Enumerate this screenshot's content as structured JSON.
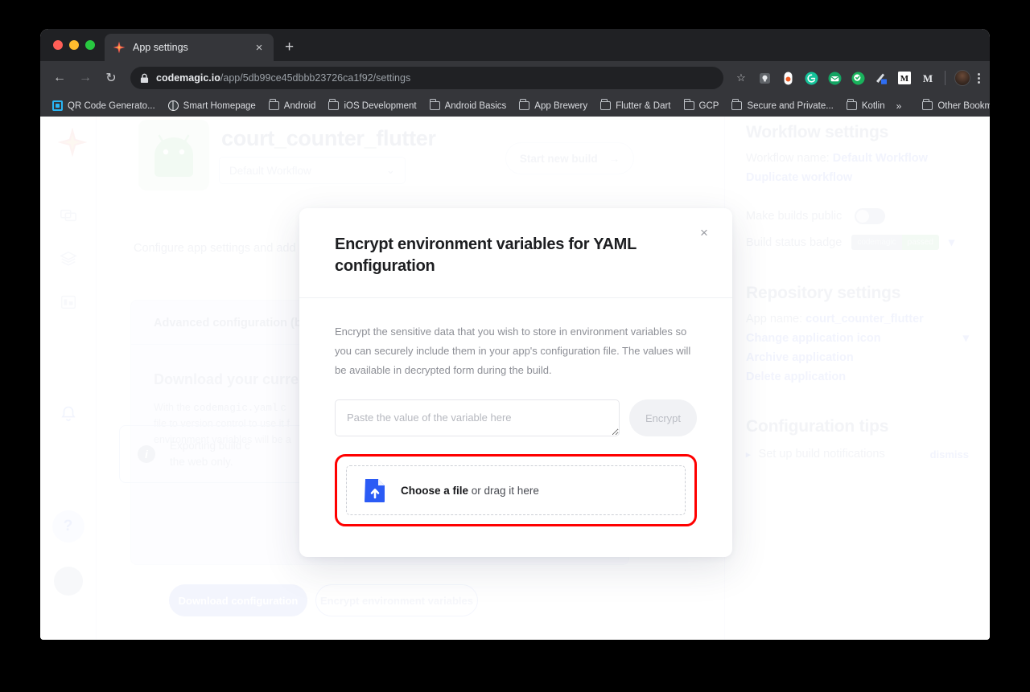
{
  "browser": {
    "tab": {
      "title": "App settings",
      "favicon": "codemagic-diamond-icon",
      "close": "×"
    },
    "new_tab_label": "+",
    "nav": {
      "back": "←",
      "forward": "→",
      "reload": "↻"
    },
    "omnibox": {
      "lock": "lock-icon",
      "url_domain": "codemagic.io",
      "url_path": "/app/5db99ce45dbbb23726ca1f92/settings"
    },
    "toolbar_icons": [
      "star-icon",
      "lightbulb-badge-icon",
      "pill-extension-icon",
      "grammarly-icon",
      "envelope-icon",
      "shield-check-icon",
      "pencil-blue-icon",
      "medium-m-icon",
      "serif-m-icon",
      "profile-avatar",
      "kebab-menu-icon"
    ],
    "bookmarks": [
      {
        "label": "QR Code Generato...",
        "icon": "qr-code-icon"
      },
      {
        "label": "Smart Homepage",
        "icon": "globe-icon"
      },
      {
        "label": "Android",
        "icon": "folder-icon"
      },
      {
        "label": "iOS Development",
        "icon": "folder-icon"
      },
      {
        "label": "Android Basics",
        "icon": "folder-icon"
      },
      {
        "label": "App Brewery",
        "icon": "folder-icon"
      },
      {
        "label": "Flutter & Dart",
        "icon": "folder-icon"
      },
      {
        "label": "GCP",
        "icon": "folder-icon"
      },
      {
        "label": "Secure and Private...",
        "icon": "folder-icon"
      },
      {
        "label": "Kotlin",
        "icon": "folder-icon"
      }
    ],
    "bookmarks_overflow": "»",
    "other_bookmarks": {
      "label": "Other Bookmarks",
      "icon": "folder-icon"
    }
  },
  "app": {
    "logo": "codemagic-logo-icon",
    "app_icon": "android-robot-icon",
    "title": "court_counter_flutter",
    "workflow_select": {
      "value": "Default Workflow",
      "chevron": "⌄"
    },
    "start_build": {
      "label": "Start new build",
      "arrow": "→"
    },
    "configure_text": "Configure app settings and add c",
    "advanced_card": {
      "title": "Advanced configuration (beta)",
      "download_heading": "Download your current",
      "description_line1": "With the",
      "description_code": "codemagic.yaml",
      "description_line1b": "c",
      "description_line2": "file to version control to use it f",
      "description_line3": "environment variables will be a",
      "info_icon": "info-icon",
      "info_text_line1": "Exporting build c",
      "info_text_line2": "the web only.",
      "btn_download": "Download configuration",
      "btn_encrypt": "Encrypt environment variables"
    },
    "left_rail": {
      "icons": [
        "apps-icon",
        "layers-icon",
        "billing-icon",
        "bell-icon"
      ],
      "help": "?",
      "avatar": "user-avatar"
    },
    "right_panel": {
      "workflow_settings_heading": "Workflow settings",
      "workflow_name_label": "Workflow name:",
      "workflow_name_value": "Default Workflow",
      "duplicate_workflow": "Duplicate workflow",
      "make_builds_public": "Make builds public",
      "build_status_badge": "Build status badge",
      "badge_left": "codemagic",
      "badge_right": "passed",
      "badge_chevron": "▾",
      "repository_settings_heading": "Repository settings",
      "app_name_label": "App name:",
      "app_name_value": "court_counter_flutter",
      "change_application_icon": "Change application icon",
      "change_icon_chevron": "▾",
      "archive_application": "Archive application",
      "delete_application": "Delete application",
      "configuration_tips_heading": "Configuration tips",
      "tip_bullet": "▸",
      "tip_label": "Set up build notifications",
      "tip_dismiss": "dismiss"
    }
  },
  "modal": {
    "title": "Encrypt environment variables for YAML configuration",
    "close_label": "×",
    "description": "Encrypt the sensitive data that you wish to store in environment variables so you can securely include them in your app's configuration file. The values will be available in decrypted form during the build.",
    "textarea_placeholder": "Paste the value of the variable here",
    "textarea_value": "",
    "encrypt_button": "Encrypt",
    "dropzone": {
      "icon": "file-upload-icon",
      "strong_label": "Choose a file",
      "rest_label": " or drag it here"
    }
  },
  "annotation": {
    "highlight_color": "#ff0000",
    "target": "file-dropzone"
  },
  "colors": {
    "browser_chrome": "#35363a",
    "tab_strip": "#202124",
    "accent_blue": "#2b5bf5",
    "highlight_red": "#ff0000",
    "modal_bg": "#ffffff",
    "page_bg": "#000000"
  }
}
